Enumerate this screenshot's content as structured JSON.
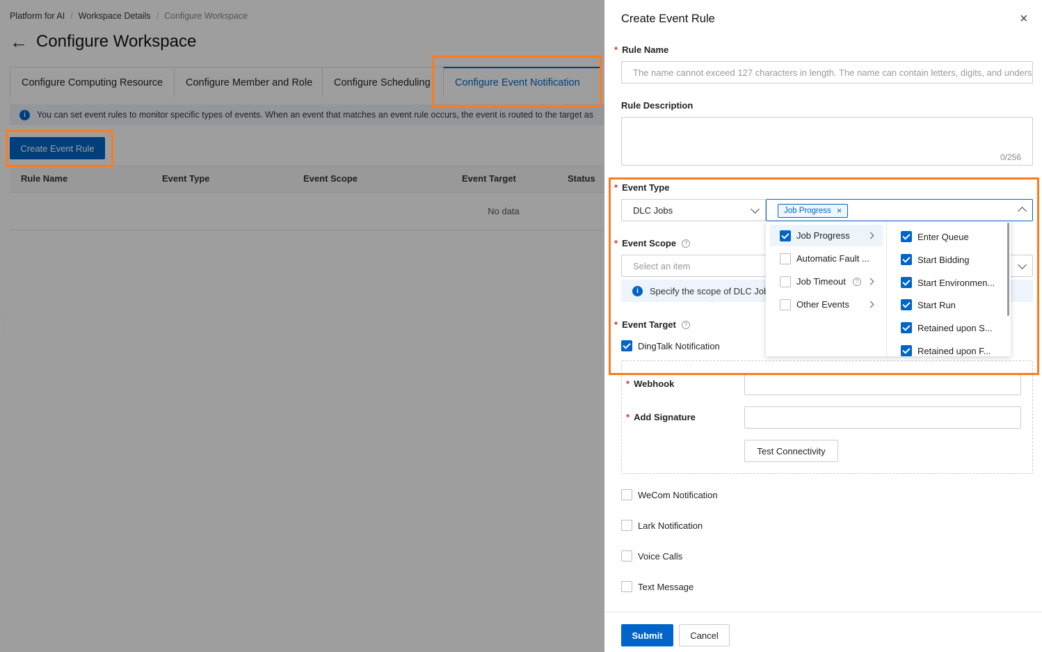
{
  "breadcrumb": {
    "items": [
      "Platform for AI",
      "Workspace Details",
      "Configure Workspace"
    ]
  },
  "page": {
    "back_icon": "←",
    "title": "Configure Workspace"
  },
  "tabs": [
    {
      "label": "Configure Computing Resource",
      "active": false
    },
    {
      "label": "Configure Member and Role",
      "active": false
    },
    {
      "label": "Configure Scheduling",
      "active": false
    },
    {
      "label": "Configure Event Notification",
      "active": true
    }
  ],
  "info_bar": {
    "icon": "i",
    "text": "You can set event rules to monitor specific types of events. When an event that matches an event rule occurs, the event is routed to the target as"
  },
  "create_button": "Create Event Rule",
  "table": {
    "columns": [
      "Rule Name",
      "Event Type",
      "Event Scope",
      "Event Target",
      "Status"
    ],
    "empty_text": "No data"
  },
  "drawer": {
    "title": "Create Event Rule",
    "close_icon": "×",
    "rule_name": {
      "label": "Rule Name",
      "placeholder": "The name cannot exceed 127 characters in length. The name can contain letters, digits, and unders"
    },
    "rule_description": {
      "label": "Rule Description",
      "counter": "0/256"
    },
    "event_type": {
      "label": "Event Type",
      "category": "DLC Jobs",
      "selected_tag": "Job Progress",
      "tag_close": "×"
    },
    "event_scope": {
      "label": "Event Scope",
      "placeholder": "Select an item",
      "info_text": "Specify the scope of DLC Job"
    },
    "event_target": {
      "label": "Event Target",
      "dingtalk": {
        "label": "DingTalk Notification",
        "checked": true
      },
      "webhook_label": "Webhook",
      "signature_label": "Add Signature",
      "test_button": "Test Connectivity",
      "other_targets": [
        {
          "label": "WeCom Notification",
          "checked": false
        },
        {
          "label": "Lark Notification",
          "checked": false
        },
        {
          "label": "Voice Calls",
          "checked": false
        },
        {
          "label": "Text Message",
          "checked": false
        }
      ]
    },
    "submit": "Submit",
    "cancel": "Cancel"
  },
  "cascader": {
    "level1": [
      {
        "label": "Job Progress",
        "checked": true,
        "has_children": true,
        "active": true
      },
      {
        "label": "Automatic Fault ...",
        "checked": false,
        "has_children": false
      },
      {
        "label": "Job Timeout",
        "checked": false,
        "has_children": true,
        "has_help": true
      },
      {
        "label": "Other Events",
        "checked": false,
        "has_children": true
      }
    ],
    "level2": [
      {
        "label": "Enter Queue",
        "checked": true
      },
      {
        "label": "Start Bidding",
        "checked": true
      },
      {
        "label": "Start Environmen...",
        "checked": true
      },
      {
        "label": "Start Run",
        "checked": true
      },
      {
        "label": "Retained upon S...",
        "checked": true
      },
      {
        "label": "Retained upon F...",
        "checked": true
      }
    ]
  },
  "colors": {
    "primary": "#0064c8",
    "highlight": "#ff7a1a",
    "required": "#d93026"
  }
}
